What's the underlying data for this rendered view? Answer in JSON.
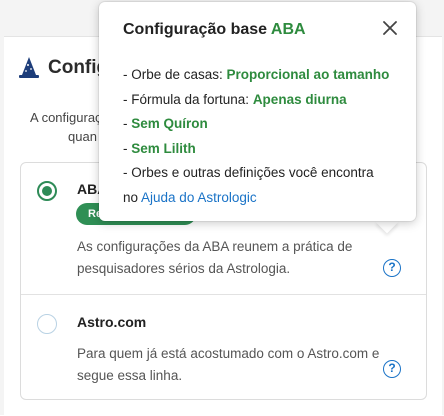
{
  "page": {
    "heading": "Configuração",
    "description_line1": "A configuração",
    "description_line2": "quan"
  },
  "options": [
    {
      "title": "ABA",
      "selected": true,
      "badge": "Recomendada",
      "description": "As configurações da ABA reunem a prática de pesquisadores sérios da Astrologia.",
      "help_icon": "help-circle-icon"
    },
    {
      "title": "Astro.com",
      "selected": false,
      "description": "Para quem já está acostumado com o Astro.com e segue essa linha.",
      "help_icon": "help-circle-icon"
    }
  ],
  "popover": {
    "title_prefix": "Configuração base ",
    "title_accent": "ABA",
    "items": [
      {
        "prefix": "- Orbe de casas: ",
        "value": "Proporcional ao tamanho"
      },
      {
        "prefix": "- Fórmula da fortuna: ",
        "value": "Apenas diurna"
      },
      {
        "prefix": "- ",
        "value": "Sem Quíron"
      },
      {
        "prefix": "- ",
        "value": "Sem Lilith"
      }
    ],
    "footer_line1": "- Orbes e outras definições você encontra",
    "footer_line2_prefix": "no ",
    "footer_link": "Ajuda do Astrologic"
  },
  "colors": {
    "accent_green": "#2e8b3e",
    "link_blue": "#1a73c7"
  }
}
